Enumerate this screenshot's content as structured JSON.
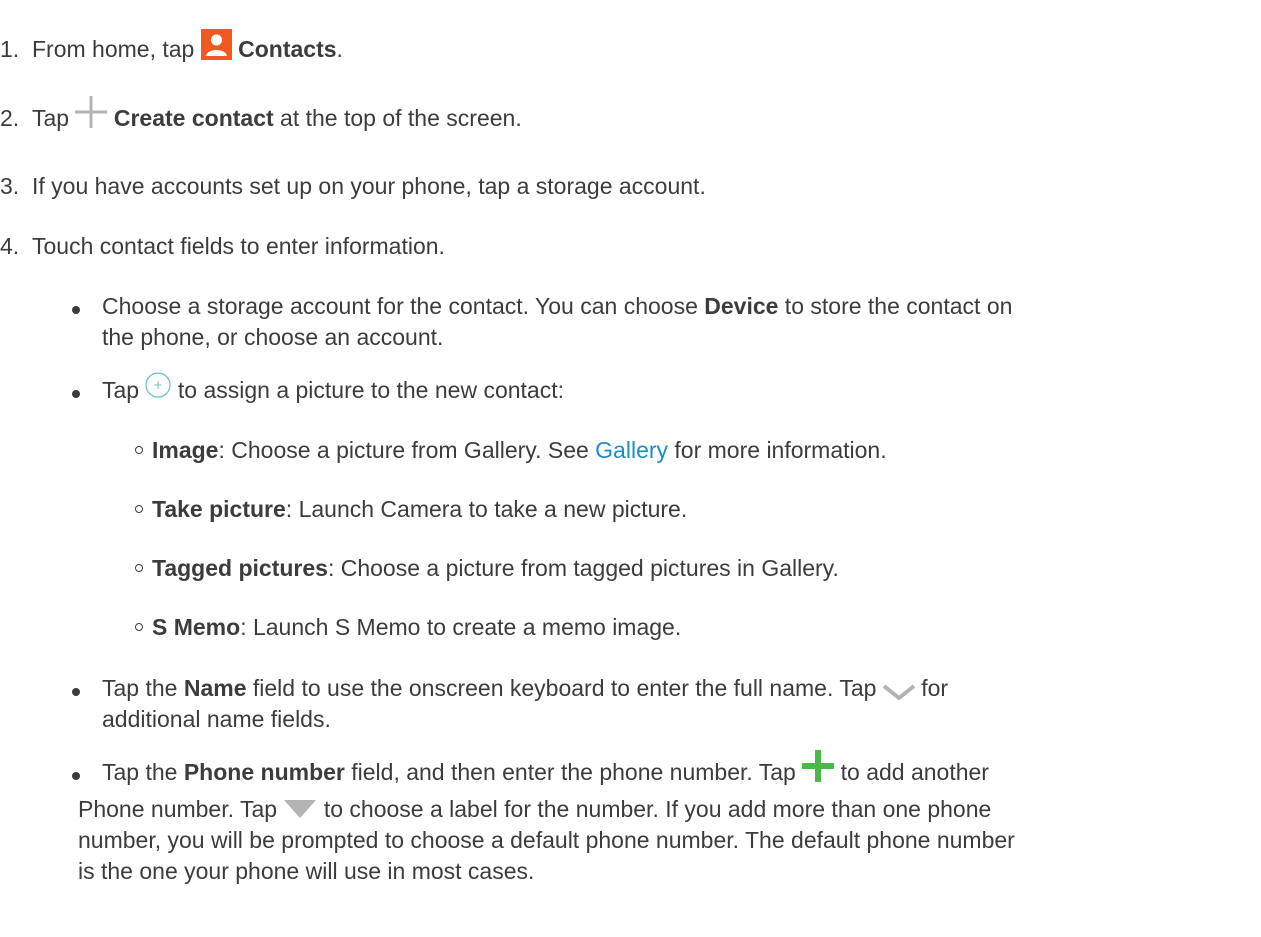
{
  "steps": [
    {
      "num": "1.",
      "pre": "From home, tap ",
      "bold": "Contacts",
      "post": ".",
      "icon": "contacts-app-icon"
    },
    {
      "num": "2.",
      "pre": "Tap ",
      "bold": "Create contact",
      "post": " at the top of the screen.",
      "icon": "plus-icon"
    },
    {
      "num": "3.",
      "text": "If you have accounts set up on your phone, tap a storage account."
    },
    {
      "num": "4.",
      "text": "Touch contact fields to enter information."
    }
  ],
  "bullets": {
    "storage": {
      "line1_pre": "Choose a storage account for the contact. You can choose ",
      "line1_bold": "Device",
      "line1_post": " to store the contact on",
      "line2": "the phone, or choose an account."
    },
    "picture": {
      "pre": "Tap ",
      "post": " to assign a picture to the new contact:",
      "icon": "add-picture-icon",
      "icon_glyph": "+",
      "sub": [
        {
          "bold": "Image",
          "text": ": Choose a picture from Gallery. See ",
          "link": "Gallery",
          "post": " for more information."
        },
        {
          "bold": "Take picture",
          "text": ": Launch Camera to take a new picture."
        },
        {
          "bold": "Tagged pictures",
          "text": ": Choose a picture from tagged pictures in Gallery."
        },
        {
          "bold": "S Memo",
          "text": ": Launch S Memo to create a memo image."
        }
      ]
    },
    "name": {
      "pre": "Tap the ",
      "bold": "Name",
      "mid": " field to use the onscreen keyboard to enter the full name. Tap ",
      "post": " for",
      "line2": "additional name fields.",
      "icon": "chevron-down-icon"
    },
    "phone": {
      "pre": "Tap the ",
      "bold": "Phone number",
      "mid": " field, and then enter the phone number. Tap ",
      "post": " to add another",
      "line2_pre": "Phone number. Tap ",
      "line2_post": " to choose a label for the number. If you add more than one phone",
      "line3": "number, you will be prompted to choose a default phone number. The default phone number",
      "line4": "is the one your phone will use in most cases.",
      "icon_add": "green-plus-icon",
      "icon_label": "triangle-down-icon"
    }
  },
  "colors": {
    "text": "#3c3c3c",
    "link": "#1a8fc4",
    "contacts_icon": "#f05a22",
    "green_plus": "#4cb848",
    "gray_icon": "#b4b4b4",
    "teal_circle": "#6cc6c0"
  }
}
